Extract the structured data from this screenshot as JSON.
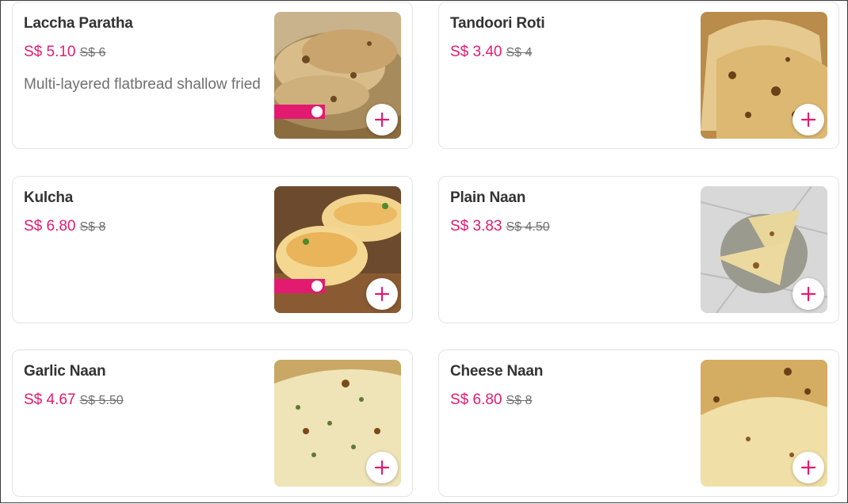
{
  "menu": {
    "items": [
      {
        "name": "Laccha Paratha",
        "price": "S$ 5.10",
        "original_price": "S$ 6",
        "description": "Multi-layered flatbread shallow fried",
        "badge": true,
        "plus_icon": "plus-icon"
      },
      {
        "name": "Tandoori Roti",
        "price": "S$ 3.40",
        "original_price": "S$ 4",
        "description": "",
        "badge": false,
        "plus_icon": "plus-icon"
      },
      {
        "name": "Kulcha",
        "price": "S$ 6.80",
        "original_price": "S$ 8",
        "description": "",
        "badge": true,
        "plus_icon": "plus-icon"
      },
      {
        "name": "Plain Naan",
        "price": "S$ 3.83",
        "original_price": "S$ 4.50",
        "description": "",
        "badge": false,
        "plus_icon": "plus-icon"
      },
      {
        "name": "Garlic Naan",
        "price": "S$ 4.67",
        "original_price": "S$ 5.50",
        "description": "",
        "badge": false,
        "plus_icon": "plus-icon"
      },
      {
        "name": "Cheese Naan",
        "price": "S$ 6.80",
        "original_price": "S$ 8",
        "description": "",
        "badge": false,
        "plus_icon": "plus-icon"
      }
    ]
  },
  "theme": {
    "accent": "#e21b70",
    "title_color": "#333333",
    "muted": "#707070"
  }
}
